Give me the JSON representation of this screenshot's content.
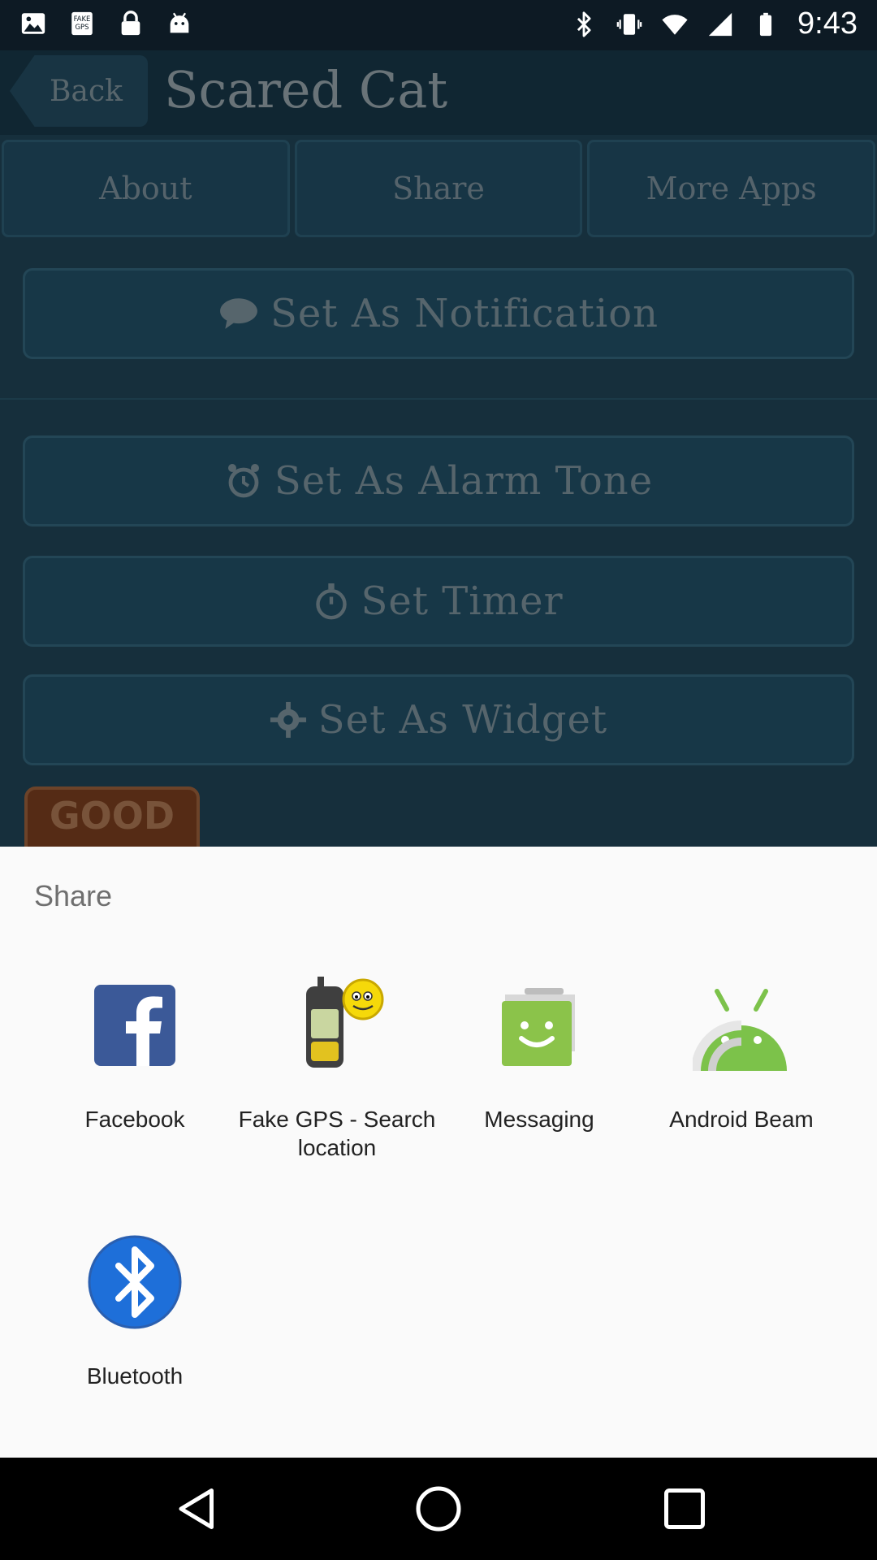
{
  "status_bar": {
    "time": "9:43",
    "left_icons": [
      "photo-icon",
      "fake-gps-icon",
      "lock-icon",
      "android-icon"
    ],
    "right_icons": [
      "bluetooth-icon",
      "vibrate-icon",
      "wifi-icon",
      "signal-icon",
      "battery-icon"
    ]
  },
  "app": {
    "back_label": "Back",
    "title": "Scared Cat",
    "tabs": [
      {
        "label": "About"
      },
      {
        "label": "Share"
      },
      {
        "label": "More Apps"
      }
    ],
    "actions": [
      {
        "label": "Set As Notification",
        "icon": "speech-bubble-icon"
      },
      {
        "label": "Set As Alarm Tone",
        "icon": "alarm-clock-icon"
      },
      {
        "label": "Set Timer",
        "icon": "stopwatch-icon"
      },
      {
        "label": "Set As Widget",
        "icon": "gear-icon"
      }
    ],
    "badge_text": "GOOD RING"
  },
  "share_sheet": {
    "title": "Share",
    "targets": [
      {
        "label": "Facebook",
        "icon": "facebook-icon"
      },
      {
        "label": "Fake GPS - Search location",
        "icon": "fake-gps-app-icon"
      },
      {
        "label": "Messaging",
        "icon": "messaging-icon"
      },
      {
        "label": "Android Beam",
        "icon": "android-beam-icon"
      },
      {
        "label": "Bluetooth",
        "icon": "bluetooth-share-icon"
      }
    ]
  },
  "nav_bar": {
    "buttons": [
      "back-nav-icon",
      "home-nav-icon",
      "recents-nav-icon"
    ]
  },
  "colors": {
    "app_background": "#2b5a73",
    "sheet_background": "#fafafa",
    "facebook_blue": "#3b5998",
    "messaging_green": "#8bc34a",
    "android_green": "#7cc24a",
    "bluetooth_blue": "#1e6fd9"
  }
}
